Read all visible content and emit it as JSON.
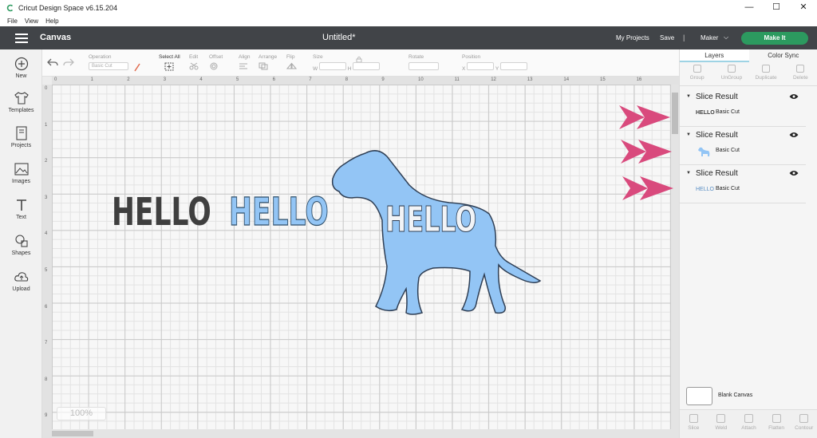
{
  "window": {
    "title": "Cricut Design Space  v6.15.204",
    "controls": {
      "minimize": "—",
      "maximize": "☐",
      "close": "✕"
    }
  },
  "menu": [
    "File",
    "View",
    "Help"
  ],
  "header": {
    "page": "Canvas",
    "doc_title": "Untitled*",
    "my_projects": "My Projects",
    "save": "Save",
    "separator": "|",
    "machine": "Maker",
    "machine_chevron": "⌵",
    "make_it": "Make It"
  },
  "left_tools": [
    {
      "label": "New",
      "icon": "plus-icon"
    },
    {
      "label": "Templates",
      "icon": "shirt-icon"
    },
    {
      "label": "Projects",
      "icon": "book-icon"
    },
    {
      "label": "Images",
      "icon": "image-icon"
    },
    {
      "label": "Text",
      "icon": "text-t-icon"
    },
    {
      "label": "Shapes",
      "icon": "shapes-icon"
    },
    {
      "label": "Upload",
      "icon": "cloud-upload-icon"
    }
  ],
  "toolbar": {
    "operation_label": "Operation",
    "operation_value": "Basic Cut",
    "select_all": "Select All",
    "edit": "Edit",
    "offset": "Offset",
    "align": "Align",
    "arrange": "Arrange",
    "flip": "Flip",
    "size": "Size",
    "size_w": "W",
    "size_h": "H",
    "rotate": "Rotate",
    "position": "Position",
    "pos_x": "X",
    "pos_y": "Y"
  },
  "rulers": {
    "top": [
      "0",
      "1",
      "2",
      "3",
      "4",
      "5",
      "6",
      "7",
      "8",
      "9",
      "10",
      "11",
      "12",
      "13",
      "14",
      "15",
      "16"
    ],
    "left": [
      "0",
      "1",
      "2",
      "3",
      "4",
      "5",
      "6",
      "7",
      "8",
      "9"
    ]
  },
  "canvas": {
    "zoom": "100%",
    "text_items": [
      {
        "text": "HELLO",
        "style": "dark"
      },
      {
        "text": "HELLO",
        "style": "blue-outlined"
      },
      {
        "text": "HELLO",
        "style": "cutout-in-dog"
      }
    ]
  },
  "layers_panel": {
    "tabs": [
      "Layers",
      "Color Sync"
    ],
    "actions": [
      "Group",
      "UnGroup",
      "Duplicate",
      "Delete"
    ],
    "groups": [
      {
        "title": "Slice Result",
        "thumb": "HELLO",
        "cut": "Basic Cut"
      },
      {
        "title": "Slice Result",
        "thumb": "",
        "cut": "Basic Cut"
      },
      {
        "title": "Slice Result",
        "thumb": "HELLO",
        "cut": "Basic Cut"
      }
    ],
    "blank_canvas": "Blank Canvas",
    "bottom_actions": [
      "Slice",
      "Weld",
      "Attach",
      "Flatten",
      "Contour"
    ]
  },
  "colors": {
    "header_bg": "#414448",
    "make_it_green": "#2c9a5f",
    "dog_blue": "#93c5f5",
    "outline_dark": "#3a3a3a",
    "pink_arrow": "#d94a7d"
  }
}
